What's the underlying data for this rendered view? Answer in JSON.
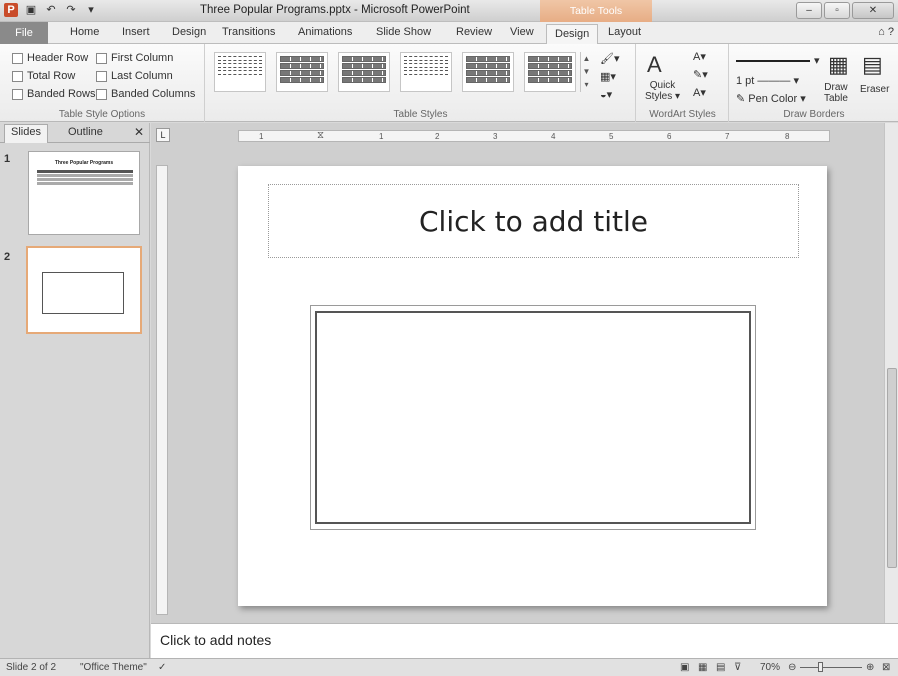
{
  "window": {
    "title": "Three Popular Programs.pptx - Microsoft PowerPoint",
    "contextual_tab_group": "Table Tools"
  },
  "tabs": [
    "File",
    "Home",
    "Insert",
    "Design",
    "Transitions",
    "Animations",
    "Slide Show",
    "Review",
    "View",
    "Design",
    "Layout"
  ],
  "active_tab": "Design",
  "ribbon": {
    "table_style_options": {
      "label": "Table Style Options",
      "checkboxes": [
        "Header Row",
        "First Column",
        "Total Row",
        "Last Column",
        "Banded Rows",
        "Banded Columns"
      ]
    },
    "table_styles": {
      "label": "Table Styles"
    },
    "wordart": {
      "label": "WordArt Styles",
      "quick_styles_line1": "Quick",
      "quick_styles_line2": "Styles"
    },
    "draw_borders": {
      "label": "Draw Borders",
      "pen_weight": "1 pt",
      "pen_color": "Pen Color",
      "draw_table_line1": "Draw",
      "draw_table_line2": "Table",
      "eraser": "Eraser"
    }
  },
  "left_panel": {
    "tabs": [
      "Slides",
      "Outline"
    ],
    "thumb1_number": "1",
    "thumb1_title": "Three Popular Programs",
    "thumb2_number": "2"
  },
  "slide": {
    "title_placeholder": "Click to add title"
  },
  "notes": {
    "placeholder": "Click to add notes"
  },
  "ruler": {
    "h_numbers": [
      "1",
      "1",
      "2",
      "3",
      "4",
      "5",
      "6",
      "7",
      "8"
    ]
  },
  "status": {
    "slide_indicator": "Slide 2 of 2",
    "theme": "\"Office Theme\"",
    "zoom": "70%"
  }
}
